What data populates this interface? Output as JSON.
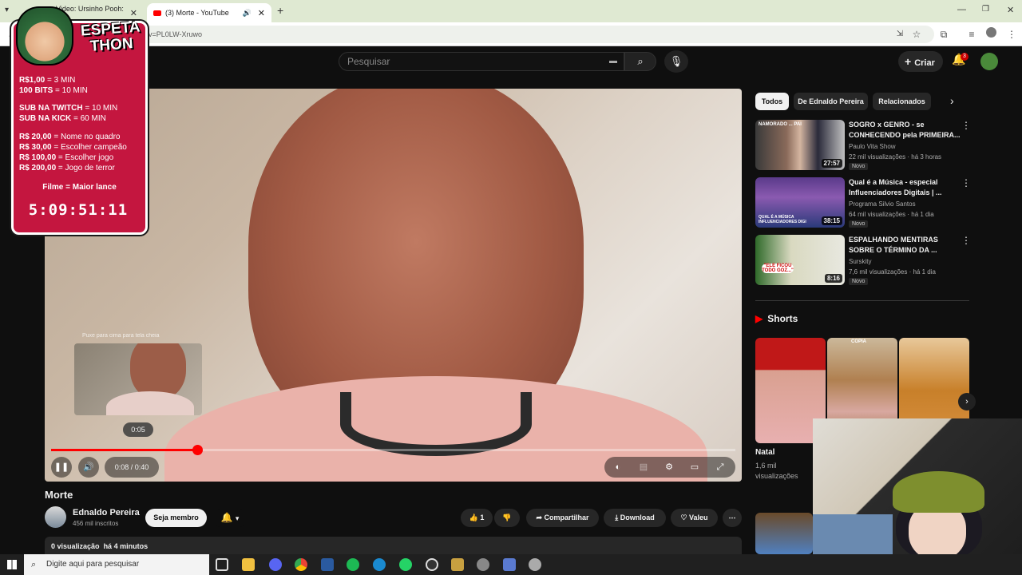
{
  "browser": {
    "tabs": [
      {
        "title": "Video: Ursinho Pooh: Sa"
      },
      {
        "title": "(3) Morte - YouTube"
      }
    ],
    "new_tab": "+",
    "url": "h?v=PL0LW-Xruwo"
  },
  "youtube": {
    "search_placeholder": "Pesquisar",
    "create_label": "Criar",
    "notification_count": "3"
  },
  "player": {
    "preview_hint": "Puxe para cima para tela cheia",
    "hover_time": "0:05",
    "time_display": "0:08 / 0:40",
    "progress_fraction": 0.213
  },
  "video": {
    "title": "Morte",
    "channel": "Ednaldo Pereira",
    "subscribers": "456 mil inscritos",
    "member_label": "Seja membro",
    "likes": "1",
    "share_label": "Compartilhar",
    "download_label": "Download",
    "thanks_label": "Valeu",
    "views": "0 visualização",
    "posted": "há 4 minutos"
  },
  "sidebar": {
    "chips": [
      "Todos",
      "De Ednaldo Pereira",
      "Relacionados"
    ],
    "recommendations": [
      {
        "title": "SOGRO x GENRO - se CONHECENDO pela PRIMEIRA...",
        "channel": "Paulo Vita Show",
        "meta": "22 mil visualizações · há 3 horas",
        "badge": "Novo",
        "duration": "27:57",
        "thumb_text": "NAMORADO ... PAI"
      },
      {
        "title": "Qual é a Música - especial Influenciadores Digitais | ...",
        "channel": "Programa Silvio Santos",
        "meta": "64 mil visualizações · há 1 dia",
        "badge": "Novo",
        "duration": "38:15",
        "thumb_text": "QUAL É A MÚSICA INFLUENCIADORES DIGI"
      },
      {
        "title": "ESPALHANDO MENTIRAS SOBRE O TÉRMINO DA ...",
        "channel": "Surskity",
        "meta": "7,6 mil visualizações · há 1 dia",
        "badge": "Novo",
        "duration": "8:16",
        "thumb_text": "\"ELE FICOU TODO GOZ...\""
      }
    ],
    "shorts_title": "Shorts",
    "shorts": [
      {
        "title": "Natal",
        "views": "1,6 mil visualizações"
      },
      {
        "title": "",
        "views": "",
        "thumb_text": "COPIA"
      },
      {
        "title": "",
        "views": ""
      }
    ]
  },
  "overlay": {
    "logo_line1": "ESPETA",
    "logo_line2": "THON",
    "lines": [
      {
        "b": "R$1,00",
        "t": " = 3 MIN"
      },
      {
        "b": "100 BITS",
        "t": " = 10 MIN"
      },
      {
        "b": "SUB NA TWITCH",
        "t": " = 10 MIN"
      },
      {
        "b": "SUB NA KICK",
        "t": " = 60 MIN"
      },
      {
        "b": "R$ 20,00",
        "t": " = Nome no quadro"
      },
      {
        "b": "R$ 30,00",
        "t": " = Escolher campeão"
      },
      {
        "b": "R$ 100,00",
        "t": " = Escolher jogo"
      },
      {
        "b": "R$ 200,00",
        "t": " = Jogo de terror"
      }
    ],
    "film": "Filme = Maior lance",
    "timer": "5:09:51:11"
  },
  "taskbar": {
    "search_placeholder": "Digite aqui para pesquisar"
  },
  "colors": {
    "accent": "#ff0000",
    "overlay_bg": "#c4163f",
    "yt_bg": "#0f0f0f"
  },
  "icons": [
    "windows-icon",
    "search-icon",
    "mic-icon",
    "bell-icon",
    "like-icon",
    "dislike-icon",
    "share-icon",
    "download-icon",
    "thanks-icon",
    "pause-icon",
    "volume-icon",
    "settings-icon",
    "fullscreen-icon",
    "chevron-right-icon"
  ]
}
